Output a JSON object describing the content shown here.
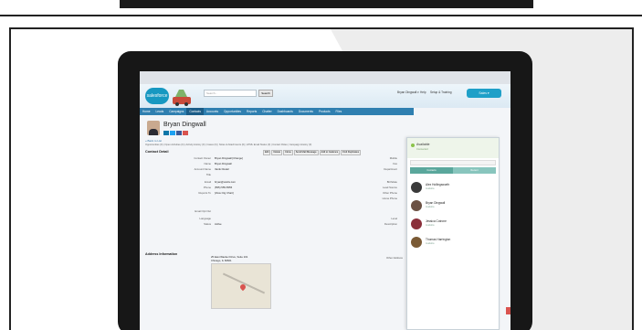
{
  "header": {
    "logo": "salesforce",
    "search_placeholder": "Search...",
    "search_button": "Search",
    "user_menu": "Bryan Dingwall ▾",
    "help": "Help",
    "setup": "Setup & Training",
    "app_menu": "Sales ▾"
  },
  "tabs": [
    {
      "label": "Home",
      "active": false
    },
    {
      "label": "Leads",
      "active": false
    },
    {
      "label": "Campaigns",
      "active": false
    },
    {
      "label": "Contacts",
      "active": true
    },
    {
      "label": "Accounts",
      "active": false
    },
    {
      "label": "Opportunities",
      "active": false
    },
    {
      "label": "Reports",
      "active": false
    },
    {
      "label": "Chatter",
      "active": false
    },
    {
      "label": "Dashboards",
      "active": false
    },
    {
      "label": "Documents",
      "active": false
    },
    {
      "label": "Products",
      "active": false
    },
    {
      "label": "Files",
      "active": false
    }
  ],
  "contact": {
    "name": "Bryan Dingwall",
    "breadcrumb": "« Back to List",
    "related_links": "Opportunities (0) | Open Activities (0) | Activity History (0) | Cases (0) | Notes & Attachments (0) | HTML Email Status (0) | Contact Roles | Campaign History (0)"
  },
  "detail": {
    "title": "Contact Detail",
    "actions": [
      "Edit",
      "Delete",
      "Clone",
      "Send Mail Message",
      "Add to Cadence",
      "Find Duplicates"
    ],
    "rows": [
      {
        "label": "Contact Owner",
        "value": "Bryan Dingwall [Change]",
        "right_label": "Mobile"
      },
      {
        "label": "Name",
        "value": "Bryan Dingwall",
        "right_label": "Fax"
      },
      {
        "label": "Account Name",
        "value": "Vantiv Retail",
        "right_label": "Department"
      },
      {
        "label": "Title",
        "value": "",
        "right_label": ""
      },
      {
        "label": "Email",
        "value": "bryan@vantiv.com",
        "right_label": "Birthdate"
      },
      {
        "label": "Phone",
        "value": "(555) 555-5555",
        "right_label": "Lead Source"
      },
      {
        "label": "Reports To",
        "value": "[View Org Chart]",
        "right_label": "Other Phone"
      },
      {
        "label": "",
        "value": "",
        "right_label": "Home Phone"
      },
      {
        "label": "Email Opt Out",
        "value": "",
        "right_label": ""
      },
      {
        "label": "Language",
        "value": "",
        "right_label": "Level"
      },
      {
        "label": "Status",
        "value": "Active",
        "right_label": "Description"
      }
    ]
  },
  "address": {
    "title": "Address Information",
    "label": "Mailing Address",
    "line1": "25 East Wacker Drive, Suite 101",
    "line2": "Chicago, IL 60601",
    "other_label": "Other Address"
  },
  "panel": {
    "status": "Available",
    "status_sub": "Connected",
    "tabs": [
      "Contacts",
      "Recent"
    ],
    "people": [
      {
        "name": "Alex Hollingsworth",
        "status": "Available"
      },
      {
        "name": "Bryan Dingwall",
        "status": "Available"
      },
      {
        "name": "Jessica Cotrone",
        "status": "Available"
      },
      {
        "name": "Thomas Harrington",
        "status": "Available"
      }
    ]
  },
  "colors": {
    "nav": "#2f7fb0",
    "accent": "#1fa0c8",
    "panel_tab": "#5aa79c",
    "available": "#8bc34a"
  }
}
